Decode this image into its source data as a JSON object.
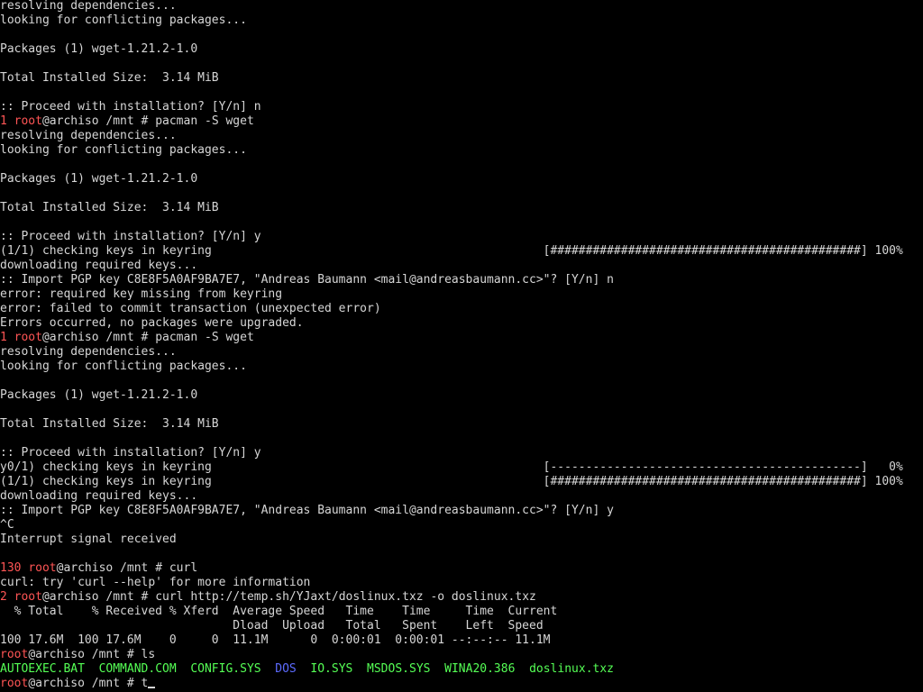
{
  "colors": {
    "background": "#000000",
    "foreground": "#d6d6d6",
    "prompt_user": "#ff5555",
    "exit_code": "#ff5555",
    "executable": "#55ff55",
    "directory": "#5c6bff"
  },
  "terminal": {
    "lines": [
      {
        "kind": "text",
        "text": "resolving dependencies..."
      },
      {
        "kind": "text",
        "text": "looking for conflicting packages..."
      },
      {
        "kind": "text",
        "text": ""
      },
      {
        "kind": "text",
        "text": "Packages (1) wget-1.21.2-1.0"
      },
      {
        "kind": "text",
        "text": ""
      },
      {
        "kind": "text",
        "text": "Total Installed Size:  3.14 MiB"
      },
      {
        "kind": "text",
        "text": ""
      },
      {
        "kind": "text",
        "text": ":: Proceed with installation? [Y/n] n"
      },
      {
        "kind": "prompt",
        "code": "1",
        "user": "root",
        "host": "@archiso /mnt # ",
        "cmd": "pacman -S wget"
      },
      {
        "kind": "text",
        "text": "resolving dependencies..."
      },
      {
        "kind": "text",
        "text": "looking for conflicting packages..."
      },
      {
        "kind": "text",
        "text": ""
      },
      {
        "kind": "text",
        "text": "Packages (1) wget-1.21.2-1.0"
      },
      {
        "kind": "text",
        "text": ""
      },
      {
        "kind": "text",
        "text": "Total Installed Size:  3.14 MiB"
      },
      {
        "kind": "text",
        "text": ""
      },
      {
        "kind": "text",
        "text": ":: Proceed with installation? [Y/n] y"
      },
      {
        "kind": "text",
        "text": "(1/1) checking keys in keyring                                               [############################################] 100%"
      },
      {
        "kind": "text",
        "text": "downloading required keys..."
      },
      {
        "kind": "text",
        "text": ":: Import PGP key C8E8F5A0AF9BA7E7, \"Andreas Baumann <mail@andreasbaumann.cc>\"? [Y/n] n"
      },
      {
        "kind": "text",
        "text": "error: required key missing from keyring"
      },
      {
        "kind": "text",
        "text": "error: failed to commit transaction (unexpected error)"
      },
      {
        "kind": "text",
        "text": "Errors occurred, no packages were upgraded."
      },
      {
        "kind": "prompt",
        "code": "1",
        "user": "root",
        "host": "@archiso /mnt # ",
        "cmd": "pacman -S wget"
      },
      {
        "kind": "text",
        "text": "resolving dependencies..."
      },
      {
        "kind": "text",
        "text": "looking for conflicting packages..."
      },
      {
        "kind": "text",
        "text": ""
      },
      {
        "kind": "text",
        "text": "Packages (1) wget-1.21.2-1.0"
      },
      {
        "kind": "text",
        "text": ""
      },
      {
        "kind": "text",
        "text": "Total Installed Size:  3.14 MiB"
      },
      {
        "kind": "text",
        "text": ""
      },
      {
        "kind": "text",
        "text": ":: Proceed with installation? [Y/n] y"
      },
      {
        "kind": "text",
        "text": "y0/1) checking keys in keyring                                               [--------------------------------------------]   0%"
      },
      {
        "kind": "text",
        "text": "(1/1) checking keys in keyring                                               [############################################] 100%"
      },
      {
        "kind": "text",
        "text": "downloading required keys..."
      },
      {
        "kind": "text",
        "text": ":: Import PGP key C8E8F5A0AF9BA7E7, \"Andreas Baumann <mail@andreasbaumann.cc>\"? [Y/n] y"
      },
      {
        "kind": "text",
        "text": "^C"
      },
      {
        "kind": "text",
        "text": "Interrupt signal received"
      },
      {
        "kind": "text",
        "text": ""
      },
      {
        "kind": "prompt",
        "code": "130",
        "user": "root",
        "host": "@archiso /mnt # ",
        "cmd": "curl"
      },
      {
        "kind": "text",
        "text": "curl: try 'curl --help' for more information"
      },
      {
        "kind": "prompt",
        "code": "2",
        "user": "root",
        "host": "@archiso /mnt # ",
        "cmd": "curl http://temp.sh/YJaxt/doslinux.txz -o doslinux.txz"
      },
      {
        "kind": "text",
        "text": "  % Total    % Received % Xferd  Average Speed   Time    Time     Time  Current"
      },
      {
        "kind": "text",
        "text": "                                 Dload  Upload   Total   Spent    Left  Speed"
      },
      {
        "kind": "text",
        "text": "100 17.6M  100 17.6M    0     0  11.1M      0  0:00:01  0:00:01 --:--:-- 11.1M"
      },
      {
        "kind": "prompt",
        "code": "",
        "user": "root",
        "host": "@archiso /mnt # ",
        "cmd": "ls"
      },
      {
        "kind": "ls",
        "entries": [
          {
            "name": "AUTOEXEC.BAT",
            "type": "executable",
            "gap": "  "
          },
          {
            "name": "COMMAND.COM",
            "type": "executable",
            "gap": "  "
          },
          {
            "name": "CONFIG.SYS",
            "type": "executable",
            "gap": "  "
          },
          {
            "name": "DOS",
            "type": "directory",
            "gap": "  "
          },
          {
            "name": "IO.SYS",
            "type": "executable",
            "gap": "  "
          },
          {
            "name": "MSDOS.SYS",
            "type": "executable",
            "gap": "  "
          },
          {
            "name": "WINA20.386",
            "type": "executable",
            "gap": "  "
          },
          {
            "name": "doslinux.txz",
            "type": "executable",
            "gap": ""
          }
        ]
      },
      {
        "kind": "prompt",
        "code": "",
        "user": "root",
        "host": "@archiso /mnt # ",
        "cmd": "t",
        "cursor": true
      }
    ]
  }
}
